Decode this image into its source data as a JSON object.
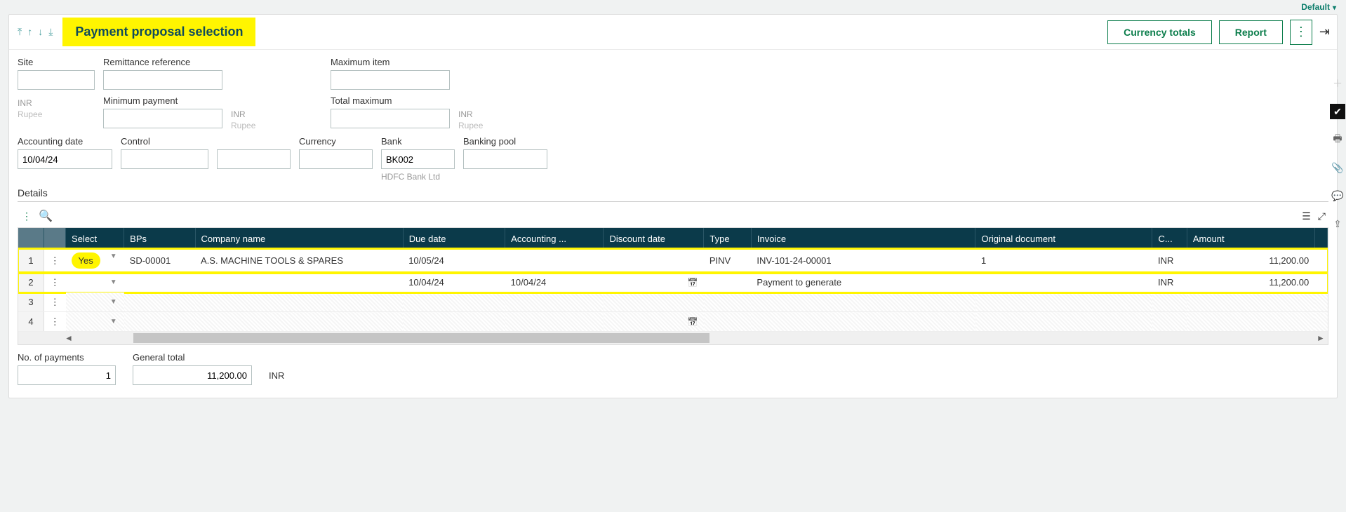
{
  "topbar": {
    "default_label": "Default"
  },
  "header": {
    "title": "Payment proposal selection",
    "currency_totals_btn": "Currency totals",
    "report_btn": "Report"
  },
  "fields": {
    "site_label": "Site",
    "remit_label": "Remittance reference",
    "maxitem_label": "Maximum item",
    "minpay_label": "Minimum payment",
    "totmax_label": "Total maximum",
    "cur1_code": "INR",
    "cur1_name": "Rupee",
    "cur2_code": "INR",
    "cur2_name": "Rupee",
    "cur3_code": "INR",
    "cur3_name": "Rupee",
    "acctdate_label": "Accounting date",
    "acctdate_val": "10/04/24",
    "control_label": "Control",
    "currency_label": "Currency",
    "bank_label": "Bank",
    "bank_val": "BK002",
    "bank_helper": "HDFC Bank Ltd",
    "pool_label": "Banking pool"
  },
  "details": {
    "title": "Details",
    "cols": {
      "select": "Select",
      "bps": "BPs",
      "company": "Company name",
      "due": "Due date",
      "acct": "Accounting ...",
      "disc": "Discount date",
      "type": "Type",
      "invoice": "Invoice",
      "orig": "Original document",
      "curcol": "C...",
      "amount": "Amount"
    },
    "rows": [
      {
        "n": "1",
        "select": "Yes",
        "bps": "SD-00001",
        "company": "A.S. MACHINE TOOLS & SPARES",
        "due": "10/05/24",
        "acct": "",
        "disc": "",
        "type": "PINV",
        "invoice": "INV-101-24-00001",
        "orig": "1",
        "cur": "INR",
        "amount": "11,200.00"
      },
      {
        "n": "2",
        "select": "",
        "bps": "",
        "company": "",
        "due": "10/04/24",
        "acct": "10/04/24",
        "disc": "",
        "type": "",
        "invoice": "Payment to generate",
        "orig": "",
        "cur": "INR",
        "amount": "11,200.00"
      },
      {
        "n": "3",
        "select": "",
        "bps": "",
        "company": "",
        "due": "",
        "acct": "",
        "disc": "",
        "type": "",
        "invoice": "",
        "orig": "",
        "cur": "",
        "amount": ""
      },
      {
        "n": "4",
        "select": "",
        "bps": "",
        "company": "",
        "due": "",
        "acct": "",
        "disc": "",
        "type": "",
        "invoice": "",
        "orig": "",
        "cur": "",
        "amount": ""
      }
    ]
  },
  "totals": {
    "numpay_label": "No. of payments",
    "numpay_val": "1",
    "gentot_label": "General total",
    "gentot_val": "11,200.00",
    "gentot_cur": "INR"
  }
}
